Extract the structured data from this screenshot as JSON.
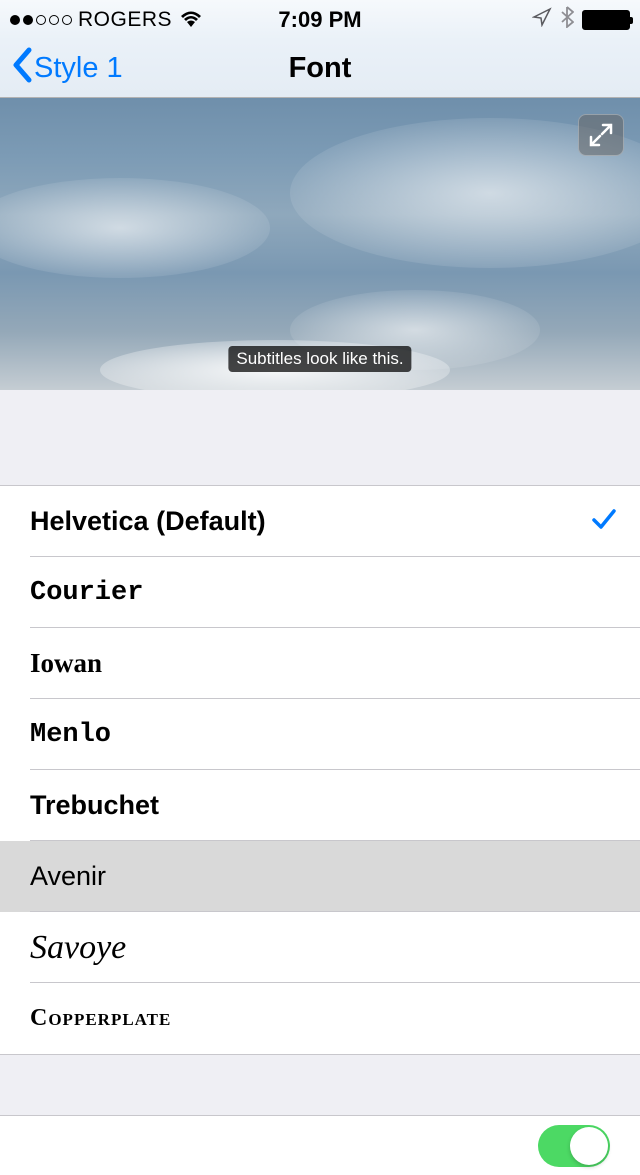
{
  "status": {
    "carrier": "ROGERS",
    "time": "7:09 PM",
    "signal_strength": 2,
    "signal_total": 5
  },
  "nav": {
    "back_label": "Style 1",
    "title": "Font"
  },
  "preview": {
    "subtitle_text": "Subtitles look like this."
  },
  "fonts": [
    {
      "label": "Helvetica (Default)",
      "css": "f-helvetica",
      "selected": true,
      "pressed": false
    },
    {
      "label": "Courier",
      "css": "f-courier",
      "selected": false,
      "pressed": false
    },
    {
      "label": "Iowan",
      "css": "f-iowan",
      "selected": false,
      "pressed": false
    },
    {
      "label": "Menlo",
      "css": "f-menlo",
      "selected": false,
      "pressed": false
    },
    {
      "label": "Trebuchet",
      "css": "f-trebuchet",
      "selected": false,
      "pressed": false
    },
    {
      "label": "Avenir",
      "css": "f-avenir",
      "selected": false,
      "pressed": true
    },
    {
      "label": "Savoye",
      "css": "f-savoye",
      "selected": false,
      "pressed": false
    },
    {
      "label": "Copperplate",
      "css": "f-copperplate",
      "selected": false,
      "pressed": false
    }
  ],
  "toggle": {
    "on": true
  }
}
